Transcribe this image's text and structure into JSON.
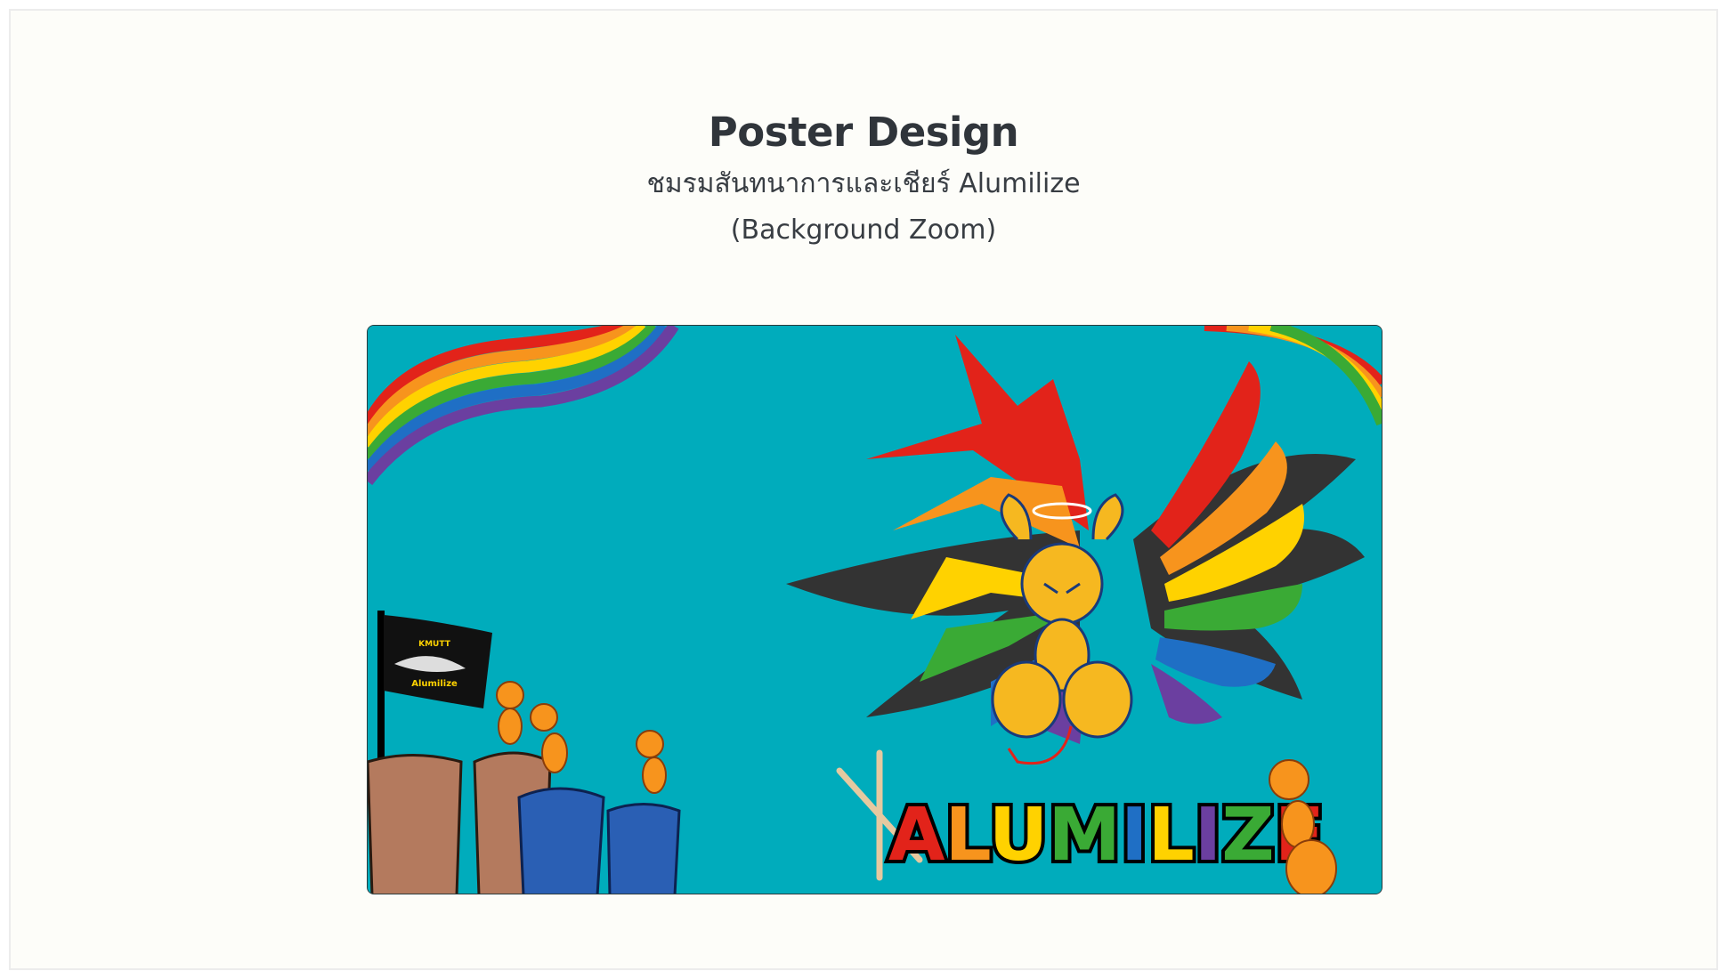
{
  "page": {
    "title": "Poster Design",
    "subtitle_line1": "ชมรมสันทนาการและเชียร์ Alumilize",
    "subtitle_line2": "(Background Zoom)"
  },
  "poster": {
    "background_color": "#00acbc",
    "logo_text": "ALUMILIZE",
    "flag_text_top": "KMUTT",
    "flag_text_bottom": "Alumilize"
  },
  "colors": {
    "heading": "#30353b",
    "page_background": "#fdfdf9",
    "rainbow": [
      "#e2231a",
      "#f7941d",
      "#ffd200",
      "#3aaa35",
      "#1f6fc5",
      "#6b3fa0"
    ]
  }
}
